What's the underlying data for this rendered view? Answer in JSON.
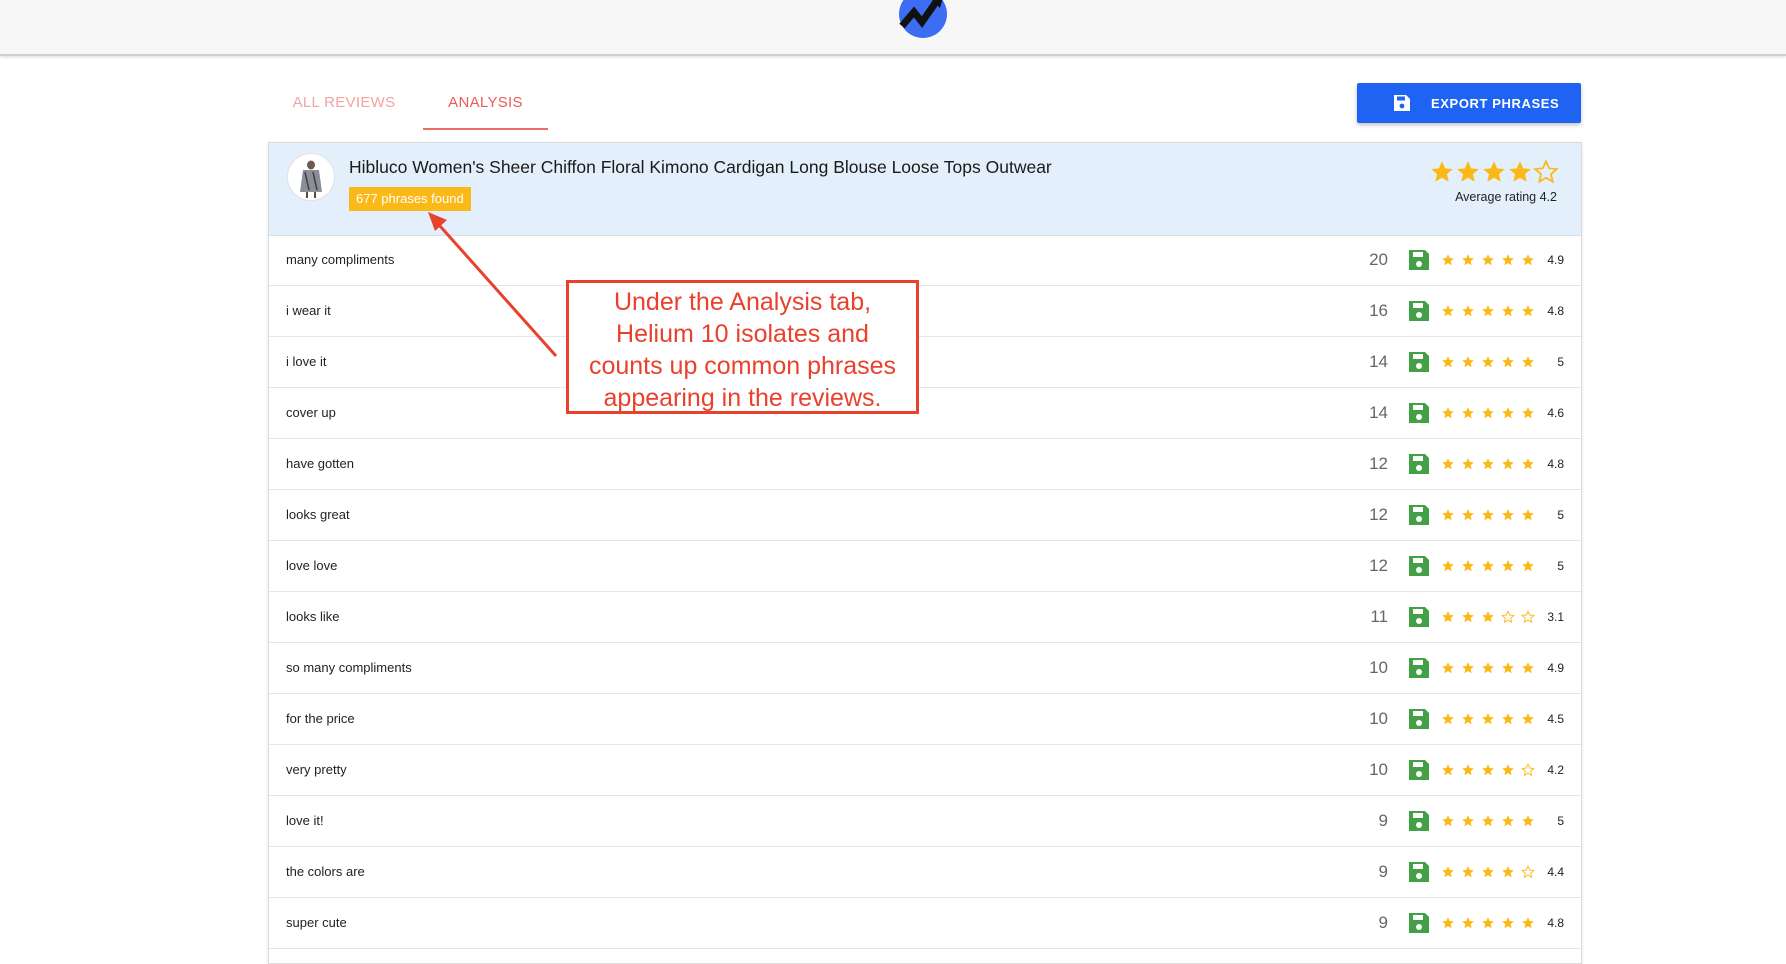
{
  "header": {
    "logo": "helium10-logo-icon"
  },
  "tabs": [
    {
      "label": "ALL REVIEWS",
      "active": false
    },
    {
      "label": "ANALYSIS",
      "active": true
    }
  ],
  "export_button": {
    "label": "EXPORT PHRASES",
    "icon": "save-icon"
  },
  "product": {
    "title": "Hibluco Women's Sheer Chiffon Floral Kimono Cardigan Long Blouse Loose Tops Outwear",
    "phrases_found": "677 phrases found",
    "stars": 4,
    "average_rating_label": "Average rating 4.2"
  },
  "phrases": [
    {
      "phrase": "many compliments",
      "count": "20",
      "rating": "4.9",
      "stars": 5
    },
    {
      "phrase": "i wear it",
      "count": "16",
      "rating": "4.8",
      "stars": 5
    },
    {
      "phrase": "i love it",
      "count": "14",
      "rating": "5",
      "stars": 5
    },
    {
      "phrase": "cover up",
      "count": "14",
      "rating": "4.6",
      "stars": 5
    },
    {
      "phrase": "have gotten",
      "count": "12",
      "rating": "4.8",
      "stars": 5
    },
    {
      "phrase": "looks great",
      "count": "12",
      "rating": "5",
      "stars": 5
    },
    {
      "phrase": "love love",
      "count": "12",
      "rating": "5",
      "stars": 5
    },
    {
      "phrase": "looks like",
      "count": "11",
      "rating": "3.1",
      "stars": 3
    },
    {
      "phrase": "so many compliments",
      "count": "10",
      "rating": "4.9",
      "stars": 5
    },
    {
      "phrase": "for the price",
      "count": "10",
      "rating": "4.5",
      "stars": 5
    },
    {
      "phrase": "very pretty",
      "count": "10",
      "rating": "4.2",
      "stars": 4
    },
    {
      "phrase": "love it!",
      "count": "9",
      "rating": "5",
      "stars": 5
    },
    {
      "phrase": "the colors are",
      "count": "9",
      "rating": "4.4",
      "stars": 4
    },
    {
      "phrase": "super cute",
      "count": "9",
      "rating": "4.8",
      "stars": 5
    }
  ],
  "annotation": {
    "lines": [
      "Under the Analysis tab,",
      "Helium 10 isolates and",
      "counts up common phrases",
      "appearing in the reviews."
    ]
  },
  "colors": {
    "accent_blue": "#1e63f2",
    "tab_active": "#ee5a5a",
    "badge": "#fbb917",
    "star": "#fbb917",
    "save_green": "#43a047",
    "callout_red": "#e8412c"
  }
}
